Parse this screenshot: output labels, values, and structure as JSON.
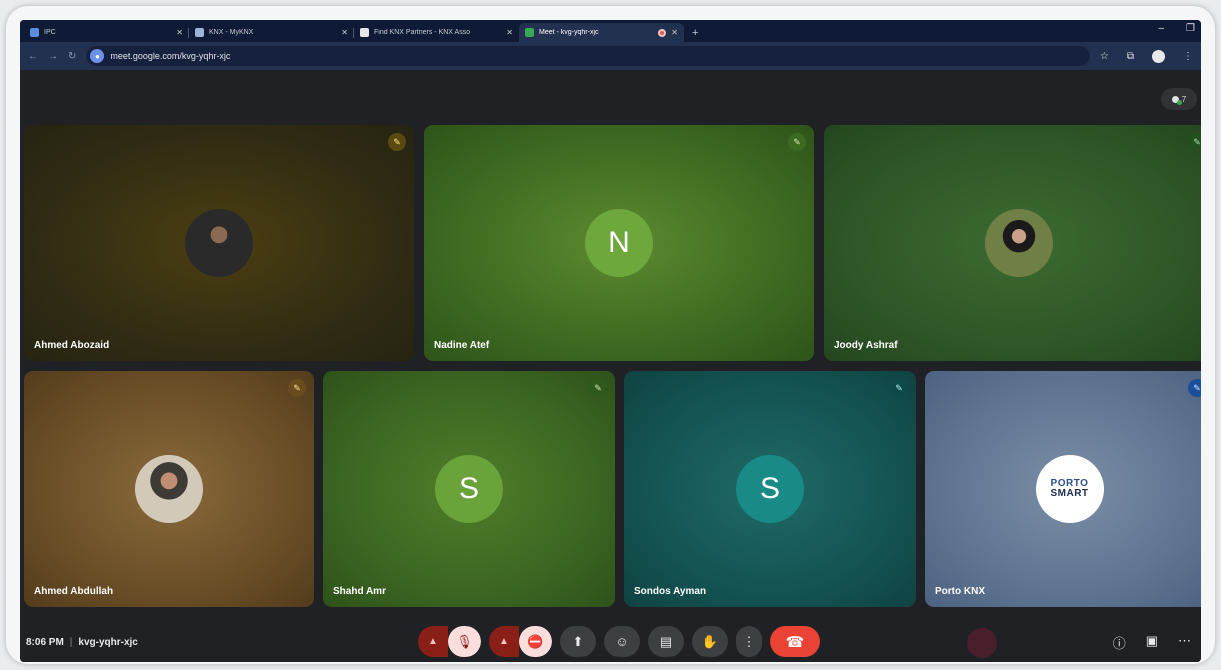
{
  "browser": {
    "tabs": [
      {
        "title": "IPC",
        "active": false
      },
      {
        "title": "KNX - MyKNX",
        "active": false
      },
      {
        "title": "Find KNX Partners - KNX Asso",
        "active": false
      },
      {
        "title": "Meet - kvg-yqhr-xjc",
        "active": true
      }
    ],
    "url": "meet.google.com/kvg-yqhr-xjc"
  },
  "participants": [
    {
      "name": "Ahmed Abozaid",
      "avatar": "photo",
      "initial": ""
    },
    {
      "name": "Nadine Atef",
      "avatar": "initial",
      "initial": "N"
    },
    {
      "name": "Joody Ashraf",
      "avatar": "photo",
      "initial": ""
    },
    {
      "name": "Ahmed Abdullah",
      "avatar": "photo",
      "initial": ""
    },
    {
      "name": "Shahd Amr",
      "avatar": "initial",
      "initial": "S"
    },
    {
      "name": "Sondos Ayman",
      "avatar": "initial",
      "initial": "S"
    },
    {
      "name": "Porto KNX",
      "avatar": "logo",
      "initial": ""
    }
  ],
  "logo": {
    "line1": "PORTO",
    "line2": "SMART"
  },
  "meeting": {
    "time": "8:06 PM",
    "separator": "|",
    "code": "kvg-yqhr-xjc"
  },
  "colors": {
    "end_call": "#ea4335",
    "muted_bg": "#f9dedc",
    "muted_arrow": "#8a1f17",
    "control_bg": "#3c4043"
  },
  "icons": {
    "mic": "mic-off-icon",
    "camera": "camera-off-icon",
    "present": "present-icon",
    "emoji": "emoji-icon",
    "captions": "captions-icon",
    "hand": "raise-hand-icon",
    "more": "more-options-icon",
    "end": "end-call-icon",
    "info": "info-icon",
    "chat": "chat-icon",
    "activities": "activities-icon"
  }
}
